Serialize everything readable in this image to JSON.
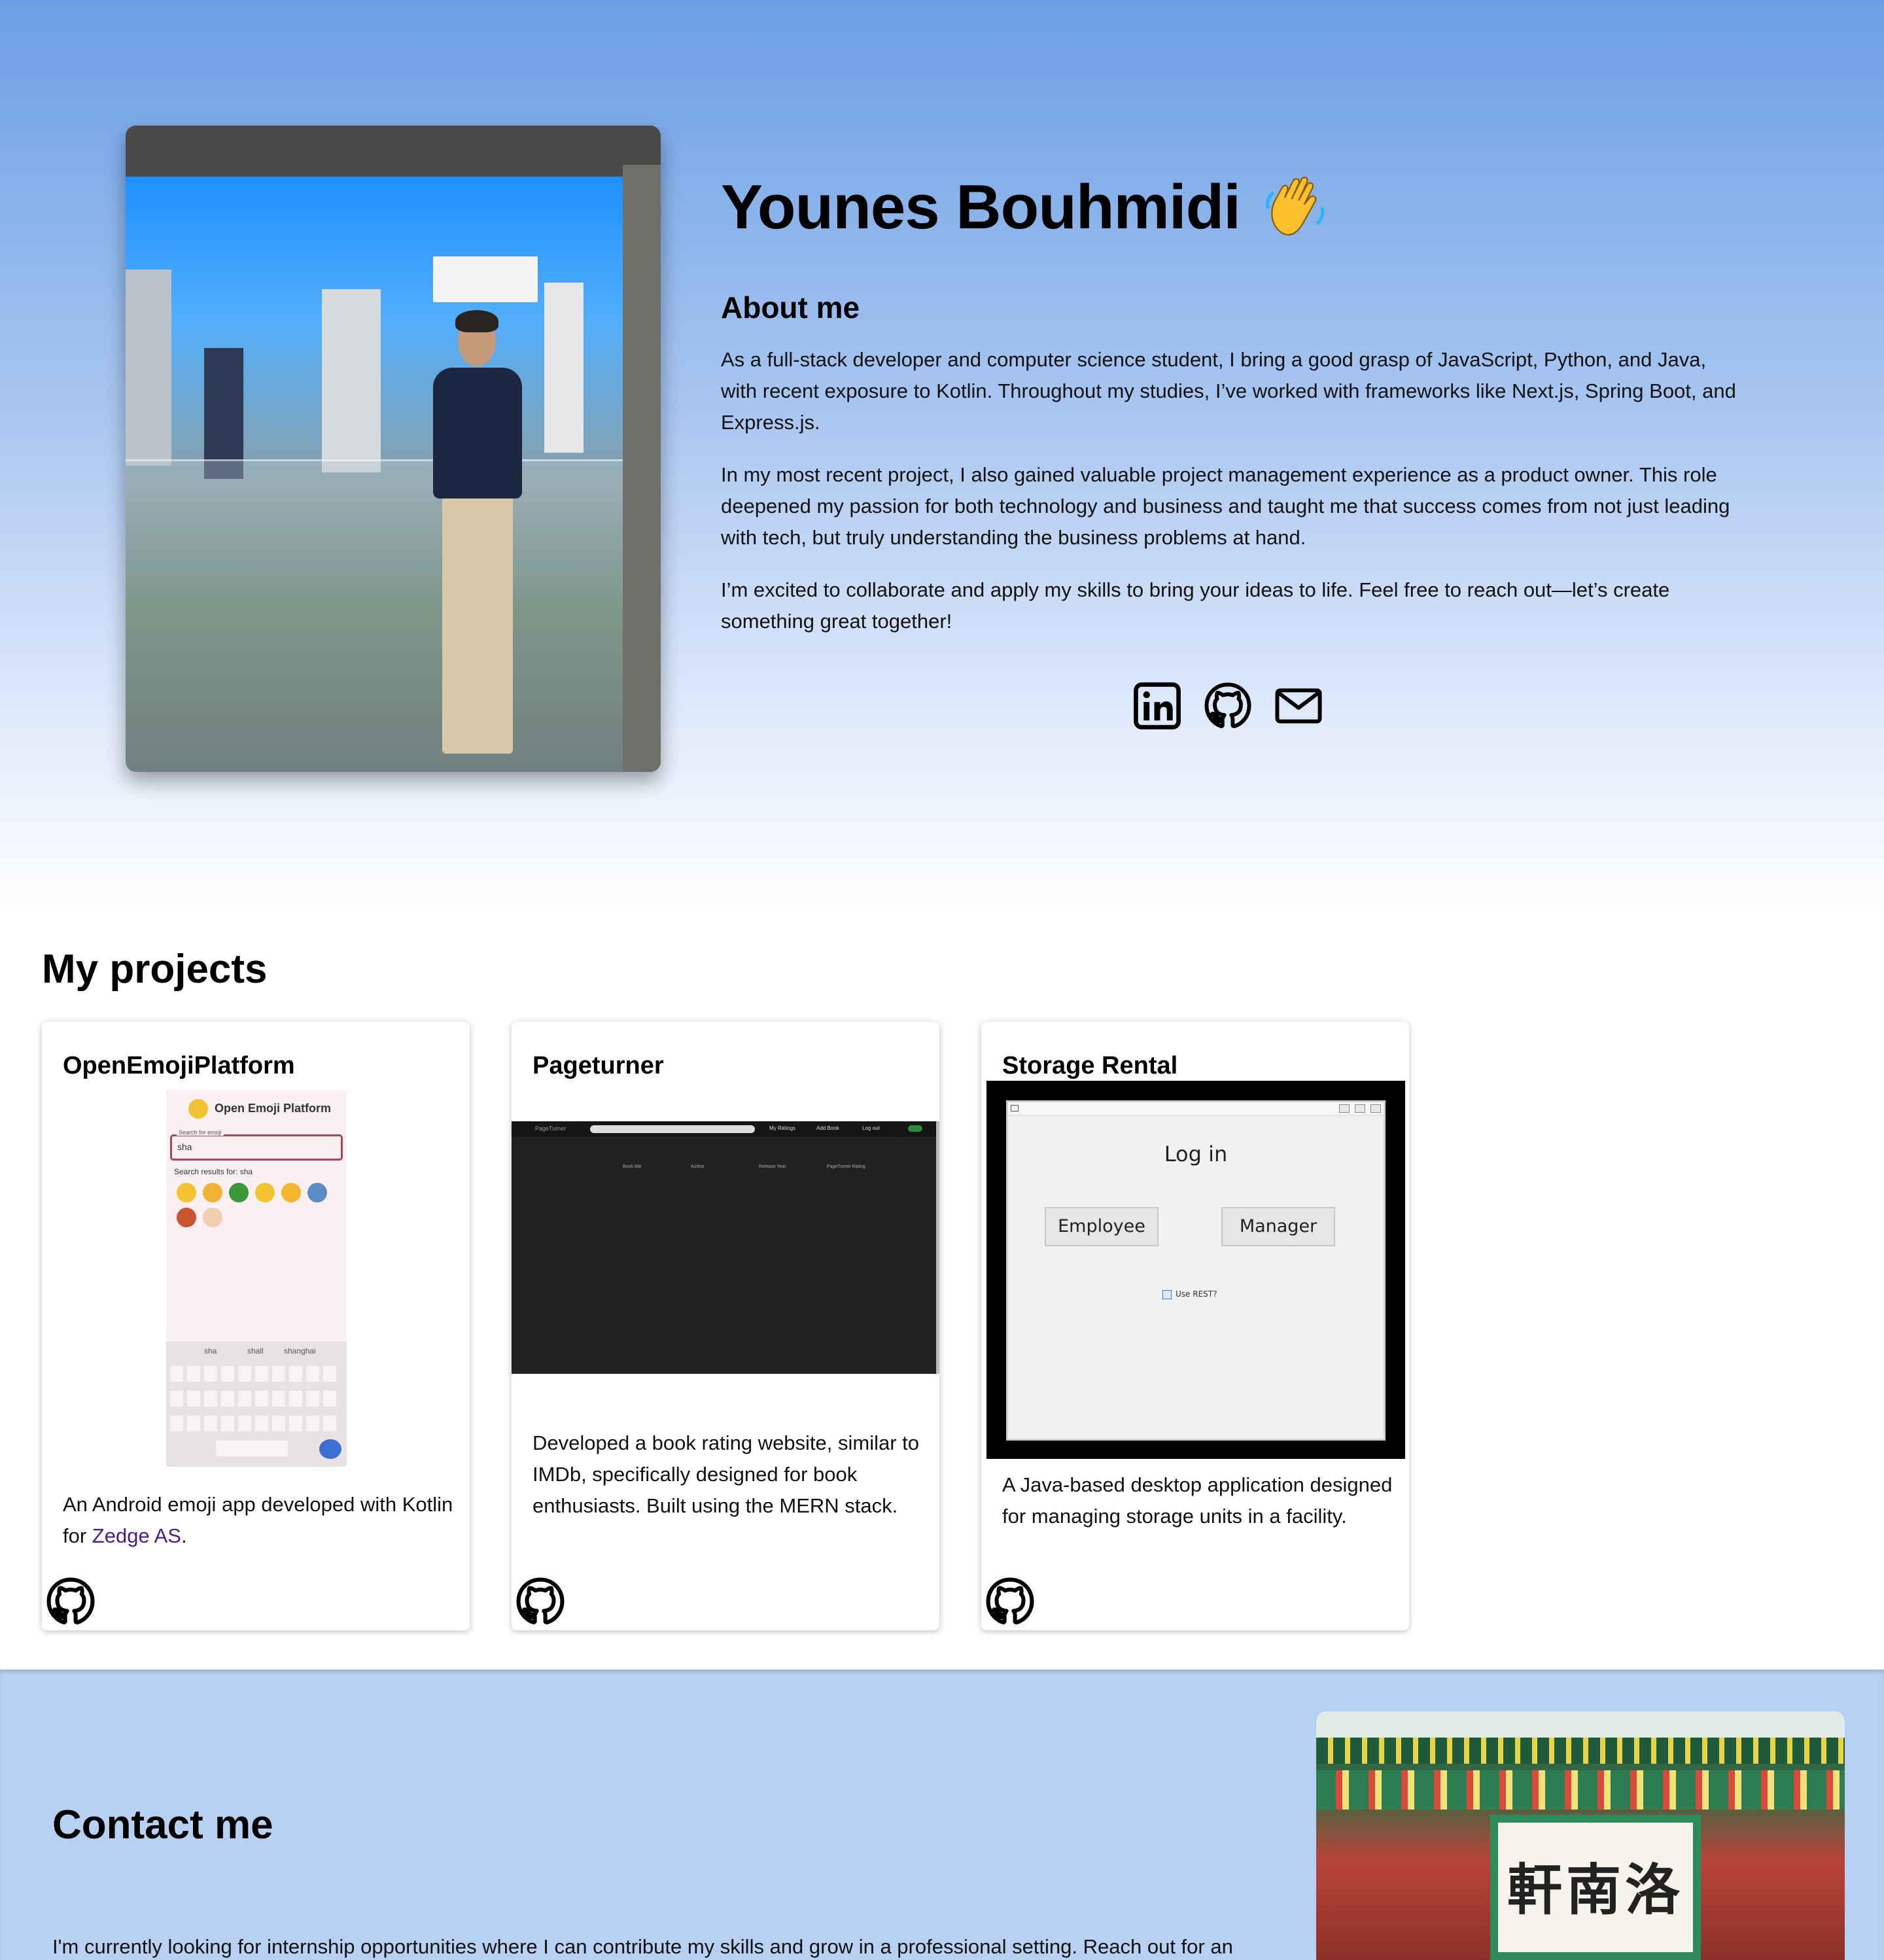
{
  "hero": {
    "name": "Younes Bouhmidi",
    "about_title": "About me",
    "about_paragraphs": [
      "As a full-stack developer and computer science student, I bring a good grasp of JavaScript, Python, and Java, with recent exposure to Kotlin. Throughout my studies, I’ve worked with frameworks like Next.js, Spring Boot, and Express.js.",
      "In my most recent project, I also gained valuable project management experience as a product owner. This role deepened my passion for both technology and business and taught me that success comes from not just leading with tech, but truly understanding the business problems at hand.",
      "I’m excited to collaborate and apply my skills to bring your ideas to life. Feel free to reach out—let’s create something great together!"
    ],
    "social_icons": [
      "linkedin-icon",
      "github-icon",
      "mail-icon"
    ]
  },
  "projects": {
    "title": "My projects",
    "cards": [
      {
        "title": "OpenEmojiPlatform",
        "desc_before_link": "An Android emoji app developed with Kotlin for ",
        "link_text": "Zedge AS",
        "desc_after_link": ".",
        "screenshot": {
          "app_title": "Open Emoji Platform",
          "search_label": "Search for emoji",
          "search_value": "sha",
          "results_label": "Search results for: sha",
          "suggestions": [
            "sha",
            "shall",
            "shanghai"
          ]
        }
      },
      {
        "title": "Pageturner",
        "description": "Developed a book rating website, similar to IMDb, specifically designed for book enthusiasts. Built using the MERN stack.",
        "screenshot": {
          "app_title": "PageTurner",
          "nav": [
            "My Ratings",
            "Add Book",
            "Log out"
          ],
          "columns": [
            "Book title",
            "Author",
            "Release Year",
            "PageTurner Rating"
          ]
        }
      },
      {
        "title": "Storage Rental",
        "description": "A Java-based desktop application designed for managing storage units in a facility.",
        "screenshot": {
          "heading": "Log in",
          "buttons": [
            "Employee",
            "Manager"
          ],
          "checkbox_label": "Use REST?"
        }
      }
    ]
  },
  "contact": {
    "title": "Contact me",
    "text": "I'm currently looking for internship opportunities where I can contribute my skills and grow in a professional setting. Reach out for an",
    "image_sign": "軒南洛"
  },
  "colors": {
    "hero_top": "#6a9fe5",
    "contact_bg": "#b8d1f2",
    "link": "#4b1b8c"
  }
}
